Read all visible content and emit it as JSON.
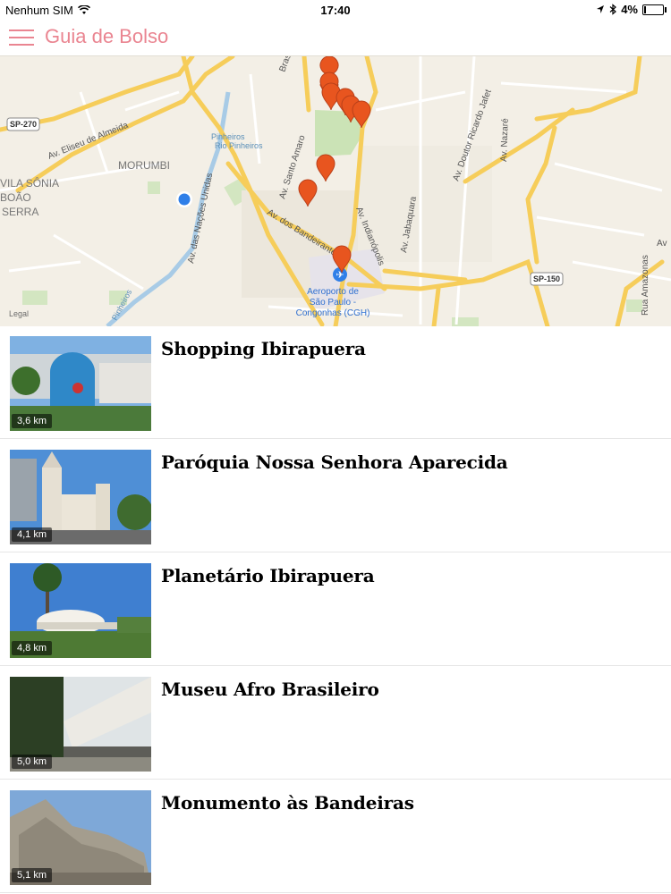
{
  "status_bar": {
    "carrier": "Nenhum SIM",
    "time": "17:40",
    "battery": "4%"
  },
  "nav": {
    "title": "Guia de Bolso",
    "menu_icon": "hamburger-menu-icon"
  },
  "map": {
    "labels": {
      "sp270": "SP-270",
      "av_eliseu": "Av. Eliseu de Almeida",
      "morumbi": "MORUMBI",
      "vila_sonia": "VILA SÔNIA",
      "boao": "BOÃO",
      "serra": "SERRA",
      "brasil": "Brasil",
      "av_santo_amaro": "Av. Santo Amaro",
      "rio_pinheiros": "Rio Pinheiros",
      "av_nacoes": "Av. das Nações Unidas",
      "av_bandeirantes": "Av. dos Bandeirantes",
      "av_indianopolis": "Av. Indianópolis",
      "av_jabaquara": "Av. Jabaquara",
      "av_ricardo": "Av. Doutor Ricardo Jafet",
      "av_nazare": "Av. Nazaré",
      "sp150": "SP-150",
      "rua_amazonas": "Rua Amazonas",
      "pinheiros": "Pinheiros",
      "airport_1": "Aeroporto de",
      "airport_2": "São Paulo -",
      "airport_3": "Congonhas (CGH)",
      "legal": "Legal",
      "av_prefix": "Av"
    }
  },
  "places": [
    {
      "name": "Shopping Ibirapuera",
      "distance": "3,6 km"
    },
    {
      "name": "Paróquia Nossa Senhora Aparecida",
      "distance": "4,1 km"
    },
    {
      "name": "Planetário Ibirapuera",
      "distance": "4,8 km"
    },
    {
      "name": "Museu Afro Brasileiro",
      "distance": "5,0 km"
    },
    {
      "name": "Monumento às Bandeiras",
      "distance": "5,1 km"
    }
  ],
  "colors": {
    "accent": "#ea8591",
    "pin": "#e8551f",
    "road_major": "#f6cd5a",
    "user_location": "#2f7fe8"
  }
}
